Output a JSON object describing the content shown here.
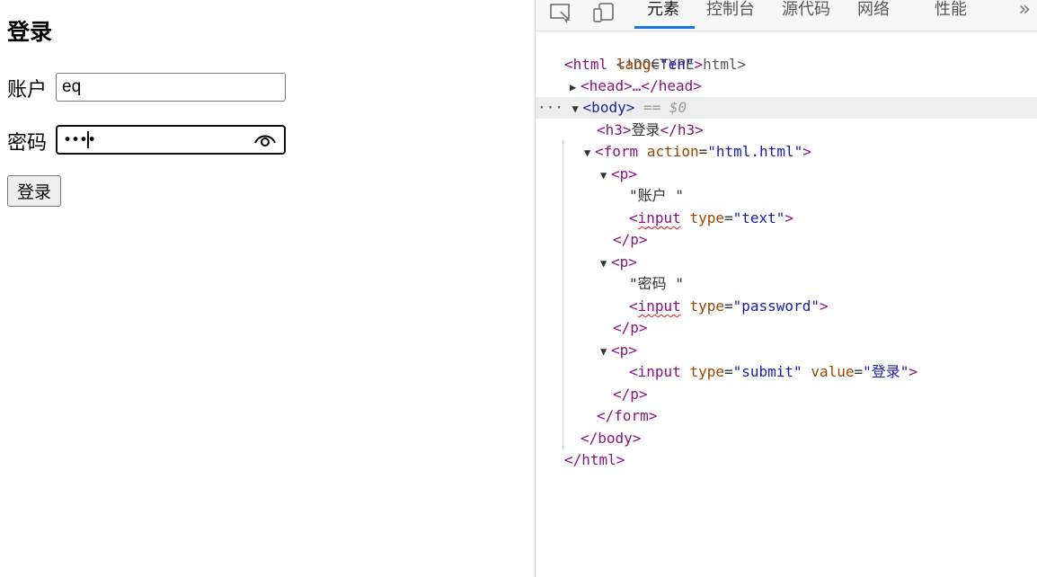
{
  "page": {
    "title": "登录",
    "account_label": "账户",
    "account_value": "eq",
    "password_label": "密码",
    "password_mask": "••••",
    "submit_label": "登录"
  },
  "devtools": {
    "tabs": [
      "元素",
      "控制台",
      "源代码",
      "网络",
      "性能"
    ],
    "active_tab": "元素",
    "more": "»",
    "tree": {
      "doctype": "<!DOCTYPE html>",
      "html_open": "<html",
      "html_attr": "lang",
      "html_val": "\"en\"",
      "head": "<head>…</head>",
      "body_open": "<body>",
      "body_marker": "== $0",
      "dots": "···",
      "h3_open": "<h3>",
      "h3_text": "登录",
      "h3_close": "</h3>",
      "form_open": "<form",
      "form_attr": "action",
      "form_val": "\"html.html\"",
      "p_open": "<p>",
      "p_close": "</p>",
      "text_account": "\"账户 \"",
      "text_password": "\"密码 \"",
      "input_tag": "input",
      "type_attr": "type",
      "value_attr": "value",
      "type_text": "\"text\"",
      "type_password": "\"password\"",
      "type_submit": "\"submit\"",
      "submit_value": "\"登录\"",
      "form_close": "</form>",
      "body_close": "</body>",
      "html_close": "</html>"
    }
  },
  "colors": {
    "accent": "#1a73e8",
    "tag": "#881280",
    "attr": "#994500",
    "value": "#1a1aa6"
  }
}
